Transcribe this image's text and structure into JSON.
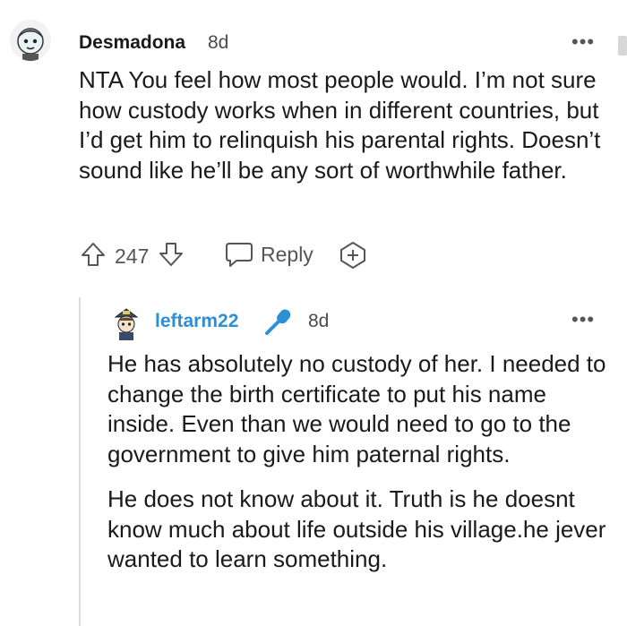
{
  "comment": {
    "username": "Desmadona",
    "time": "8d",
    "menu": "•••",
    "body": "NTA You feel how most people would. I’m not sure how custody works when in different countries, but I’d get him to relinquish his parental rights. Doesn’t sound like he’ll be any sort of worthwhile father.",
    "upvote_count": "247",
    "reply_label": "Reply"
  },
  "reply": {
    "username": "leftarm22",
    "time": "8d",
    "menu": "•••",
    "paragraphs": [
      "He has absolutely no custody of her. I needed to change the birth certificate to put his name inside. Even than we would need to go to the government to give him paternal rights.",
      "He does not know about it. Truth is he doesnt know much about life outside his village.he jever wanted to learn something."
    ]
  },
  "colors": {
    "reply_username": "#2d8fd5",
    "flair_mic": "#2d8fd5",
    "text": "#1a1a1b",
    "muted": "#555555"
  },
  "icons": {
    "flair": "microphone-icon",
    "upvote": "arrow-up-icon",
    "downvote": "arrow-down-icon",
    "reply": "speech-bubble-icon",
    "award": "award-icon"
  }
}
